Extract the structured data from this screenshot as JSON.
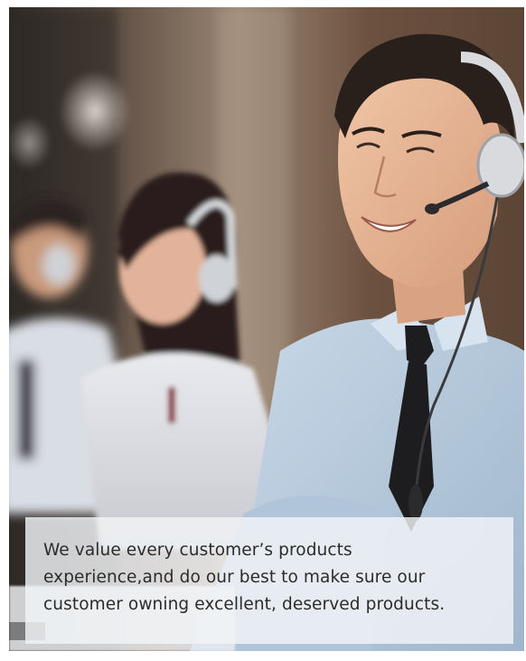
{
  "caption": {
    "lines": [
      "We value every customer’s products",
      "experience,and do our best to make sure our",
      "customer owning excellent, deserved products."
    ]
  },
  "colors": {
    "caption_background": "#f2f4f7",
    "caption_text": "#2b2b2b",
    "shirt": "#b9cde0",
    "tie": "#1d1d1f",
    "headset": "#d8dadd"
  }
}
